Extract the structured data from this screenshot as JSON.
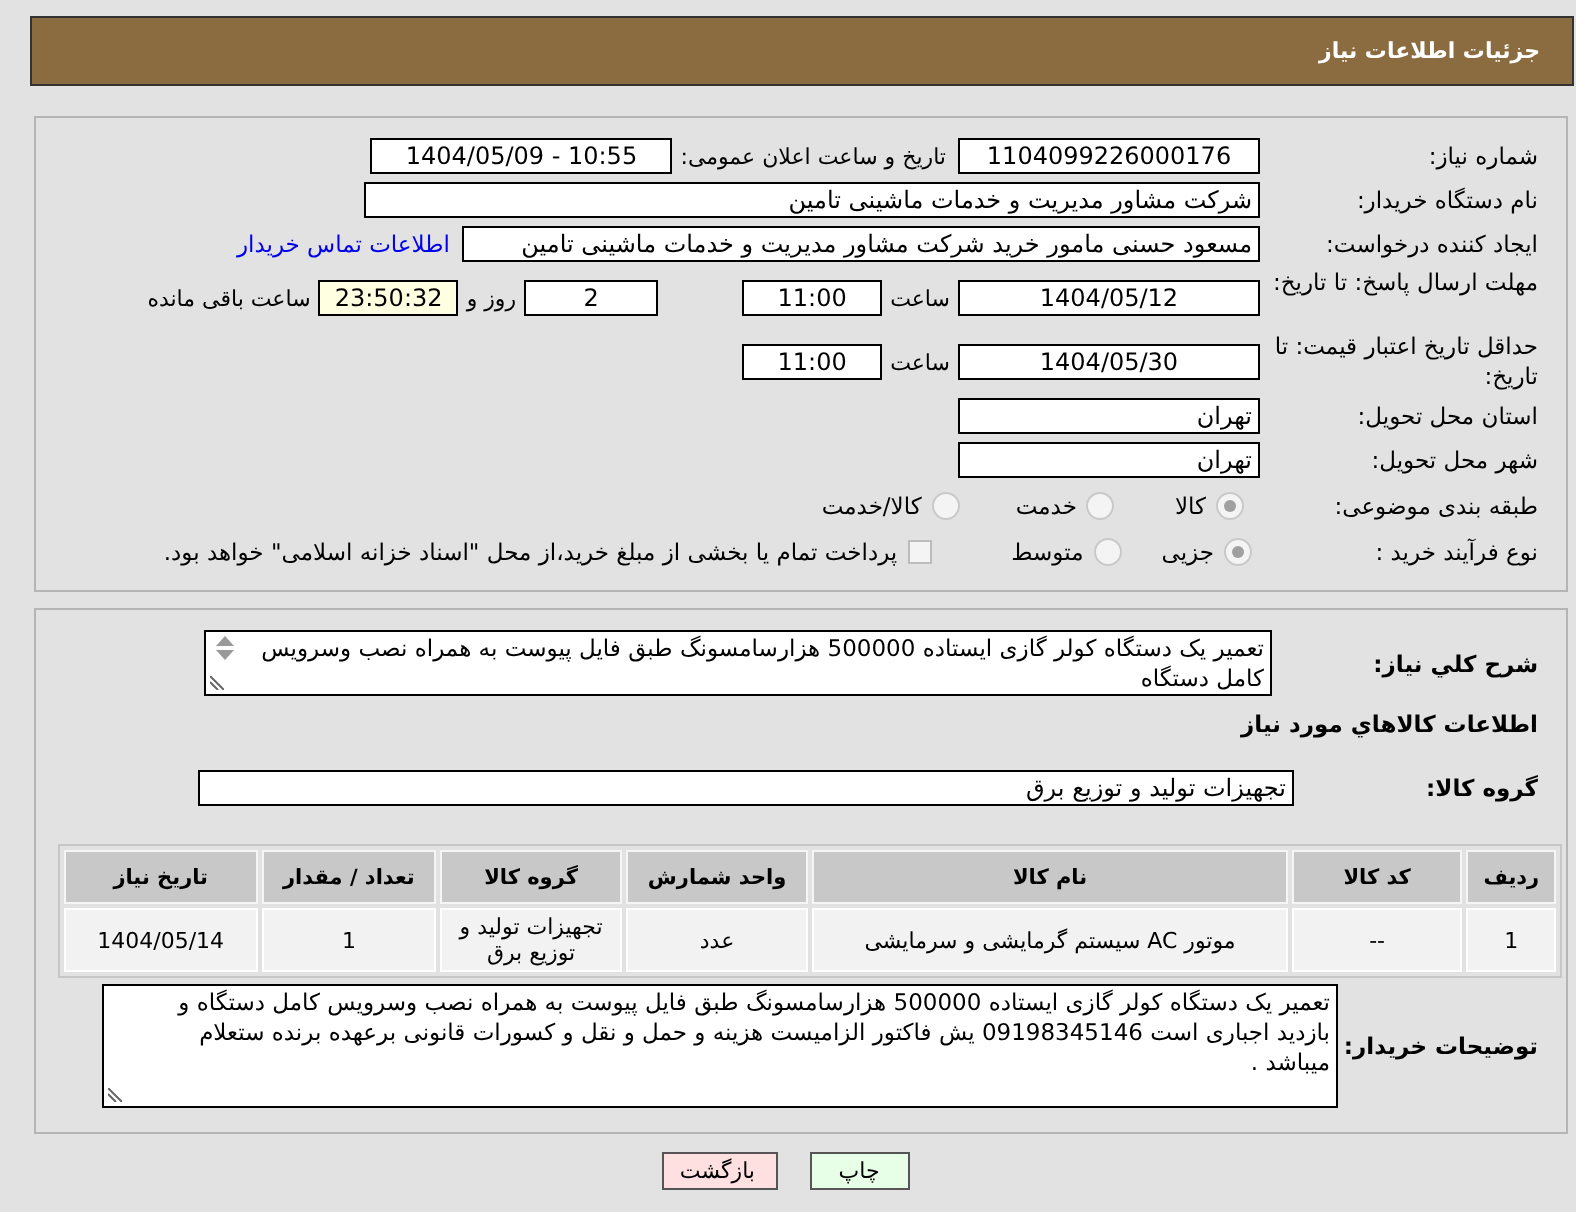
{
  "header": {
    "title": "جزئیات اطلاعات نیاز"
  },
  "need_number": {
    "label": "شماره نیاز:",
    "value": "1104099226000176"
  },
  "announce": {
    "label": "تاریخ و ساعت اعلان عمومی:",
    "value": "1404/05/09 - 10:55"
  },
  "buyer": {
    "label": "نام دستگاه خریدار:",
    "value": "شرکت مشاور مدیریت و خدمات ماشینی تامین"
  },
  "creator": {
    "label": "ایجاد کننده درخواست:",
    "value": "مسعود حسنی مامور خرید شرکت مشاور مدیریت و خدمات ماشینی تامین",
    "link": "اطلاعات تماس خریدار"
  },
  "deadline": {
    "label": "مهلت ارسال پاسخ: تا تاریخ:",
    "date": "1404/05/12",
    "time_label": "ساعت",
    "time": "11:00",
    "days": "2",
    "days_label": "روز و",
    "remaining": "23:50:32",
    "remaining_label": "ساعت باقی مانده"
  },
  "validity": {
    "label": "حداقل تاریخ اعتبار قیمت: تا تاریخ:",
    "date": "1404/05/30",
    "time_label": "ساعت",
    "time": "11:00"
  },
  "province": {
    "label": "استان محل تحویل:",
    "value": "تهران"
  },
  "city": {
    "label": "شهر محل تحویل:",
    "value": "تهران"
  },
  "category": {
    "label": "طبقه بندی موضوعی:",
    "options": [
      {
        "label": "کالا",
        "selected": true
      },
      {
        "label": "خدمت",
        "selected": false
      },
      {
        "label": "کالا/خدمت",
        "selected": false
      }
    ]
  },
  "process": {
    "label": "نوع فرآیند خرید :",
    "options": [
      {
        "label": "جزیی",
        "selected": true
      },
      {
        "label": "متوسط",
        "selected": false
      }
    ],
    "treasury": {
      "label": "پرداخت تمام یا بخشی از مبلغ خرید،از محل \"اسناد خزانه اسلامی\" خواهد بود.",
      "checked": false
    }
  },
  "description": {
    "label": "شرح کلي نياز:",
    "value": "تعمیر یک دستگاه کولر گازی ایستاده 500000 هزارسامسونگ   طبق فایل پیوست به همراه نصب وسرویس کامل دستگاه"
  },
  "goods_heading": "اطلاعات کالاهاي مورد نياز",
  "goods_group": {
    "label": "گروه کالا:",
    "value": "تجهیزات تولید و توزیع برق"
  },
  "table": {
    "columns": [
      "ردیف",
      "کد کالا",
      "نام کالا",
      "واحد شمارش",
      "گروه کالا",
      "تعداد / مقدار",
      "تاریخ نیاز"
    ],
    "rows": [
      [
        "1",
        "--",
        "موتور AC سیستم گرمایشی و سرمایشی",
        "عدد",
        "تجهیزات تولید و توزیع برق",
        "1",
        "1404/05/14"
      ]
    ]
  },
  "notes": {
    "label": "توضیحات خریدار:",
    "value": "تعمیر یک دستگاه کولر گازی ایستاده 500000 هزارسامسونگ   طبق فایل پیوست به همراه نصب وسرویس کامل دستگاه  و بازدید اجباری است  09198345146   یش فاکتور الزامیست هزینه و حمل و نقل و  کسورات قانونی برعهده  برنده ستعلام میباشد ."
  },
  "buttons": [
    {
      "label": "چاپ",
      "kind": "print"
    },
    {
      "label": "بازگشت",
      "kind": "back"
    }
  ]
}
